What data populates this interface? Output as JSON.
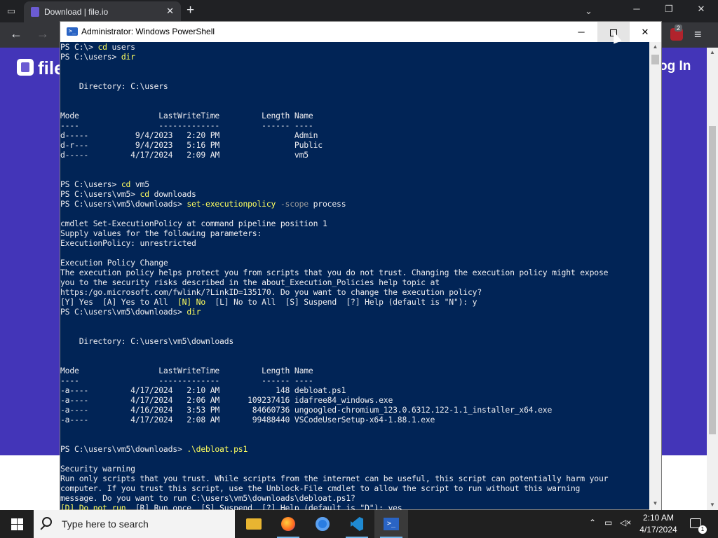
{
  "browser": {
    "tab_title": "Download | file.io",
    "tab_close": "✕",
    "new_tab": "+",
    "site": {
      "logo_text": "file",
      "login_text": "og In"
    },
    "extension_badge_count": "2"
  },
  "powershell": {
    "title": "Administrator: Windows PowerShell",
    "icon_glyph": ">_",
    "lines": [
      [
        {
          "t": "PS C:\\> "
        },
        {
          "t": "cd",
          "c": "cmd"
        },
        {
          "t": " users"
        }
      ],
      [
        {
          "t": "PS C:\\users> "
        },
        {
          "t": "dir",
          "c": "cmd"
        }
      ],
      [
        {
          "t": ""
        }
      ],
      [
        {
          "t": ""
        }
      ],
      [
        {
          "t": "    Directory: C:\\users"
        }
      ],
      [
        {
          "t": ""
        }
      ],
      [
        {
          "t": ""
        }
      ],
      [
        {
          "t": "Mode                 LastWriteTime         Length Name"
        }
      ],
      [
        {
          "t": "----                 -------------         ------ ----"
        }
      ],
      [
        {
          "t": "d-----          9/4/2023   2:20 PM                Admin"
        }
      ],
      [
        {
          "t": "d-r---          9/4/2023   5:16 PM                Public"
        }
      ],
      [
        {
          "t": "d-----         4/17/2024   2:09 AM                vm5"
        }
      ],
      [
        {
          "t": ""
        }
      ],
      [
        {
          "t": ""
        }
      ],
      [
        {
          "t": "PS C:\\users> "
        },
        {
          "t": "cd",
          "c": "cmd"
        },
        {
          "t": " vm5"
        }
      ],
      [
        {
          "t": "PS C:\\users\\vm5> "
        },
        {
          "t": "cd",
          "c": "cmd"
        },
        {
          "t": " downloads"
        }
      ],
      [
        {
          "t": "PS C:\\users\\vm5\\downloads> "
        },
        {
          "t": "set-executionpolicy",
          "c": "cmd"
        },
        {
          "t": " -scope",
          "c": "param"
        },
        {
          "t": " process"
        }
      ],
      [
        {
          "t": ""
        }
      ],
      [
        {
          "t": "cmdlet Set-ExecutionPolicy at command pipeline position 1"
        }
      ],
      [
        {
          "t": "Supply values for the following parameters:"
        }
      ],
      [
        {
          "t": "ExecutionPolicy: unrestricted"
        }
      ],
      [
        {
          "t": ""
        }
      ],
      [
        {
          "t": "Execution Policy Change"
        }
      ],
      [
        {
          "t": "The execution policy helps protect you from scripts that you do not trust. Changing the execution policy might expose"
        }
      ],
      [
        {
          "t": "you to the security risks described in the about_Execution_Policies help topic at"
        }
      ],
      [
        {
          "t": "https:/go.microsoft.com/fwlink/?LinkID=135170. Do you want to change the execution policy?"
        }
      ],
      [
        {
          "t": "[Y] Yes  [A] Yes to All  "
        },
        {
          "t": "[N] No",
          "c": "warn-hi"
        },
        {
          "t": "  [L] No to All  [S] Suspend  [?] Help (default is \"N\"): y"
        }
      ],
      [
        {
          "t": "PS C:\\users\\vm5\\downloads> "
        },
        {
          "t": "dir",
          "c": "cmd"
        }
      ],
      [
        {
          "t": ""
        }
      ],
      [
        {
          "t": ""
        }
      ],
      [
        {
          "t": "    Directory: C:\\users\\vm5\\downloads"
        }
      ],
      [
        {
          "t": ""
        }
      ],
      [
        {
          "t": ""
        }
      ],
      [
        {
          "t": "Mode                 LastWriteTime         Length Name"
        }
      ],
      [
        {
          "t": "----                 -------------         ------ ----"
        }
      ],
      [
        {
          "t": "-a----         4/17/2024   2:10 AM            148 debloat.ps1"
        }
      ],
      [
        {
          "t": "-a----         4/17/2024   2:06 AM      109237416 idafree84_windows.exe"
        }
      ],
      [
        {
          "t": "-a----         4/16/2024   3:53 PM       84660736 ungoogled-chromium_123.0.6312.122-1.1_installer_x64.exe"
        }
      ],
      [
        {
          "t": "-a----         4/17/2024   2:08 AM       99488440 VSCodeUserSetup-x64-1.88.1.exe"
        }
      ],
      [
        {
          "t": ""
        }
      ],
      [
        {
          "t": ""
        }
      ],
      [
        {
          "t": "PS C:\\users\\vm5\\downloads> "
        },
        {
          "t": ".\\debloat.ps1",
          "c": "cmd"
        }
      ],
      [
        {
          "t": ""
        }
      ],
      [
        {
          "t": "Security warning"
        }
      ],
      [
        {
          "t": "Run only scripts that you trust. While scripts from the internet can be useful, this script can potentially harm your"
        }
      ],
      [
        {
          "t": "computer. If you trust this script, use the Unblock-File cmdlet to allow the script to run without this warning"
        }
      ],
      [
        {
          "t": "message. Do you want to run C:\\users\\vm5\\downloads\\debloat.ps1?"
        }
      ],
      [
        {
          "t": "[D] Do not run",
          "c": "warn-hi"
        },
        {
          "t": "  [R] Run once  [S] Suspend  [?] Help (default is \"D\"): yes"
        }
      ]
    ]
  },
  "taskbar": {
    "search_placeholder": "Type here to search",
    "ps_icon_glyph": ">_",
    "clock_time": "2:10 AM",
    "clock_date": "4/17/2024",
    "notification_count": "1"
  },
  "colors": {
    "ps_background": "#012456",
    "ps_text": "#eeedf0",
    "ps_command": "#ffff5f",
    "site_brand": "#4335b8",
    "taskbar": "#202020"
  }
}
